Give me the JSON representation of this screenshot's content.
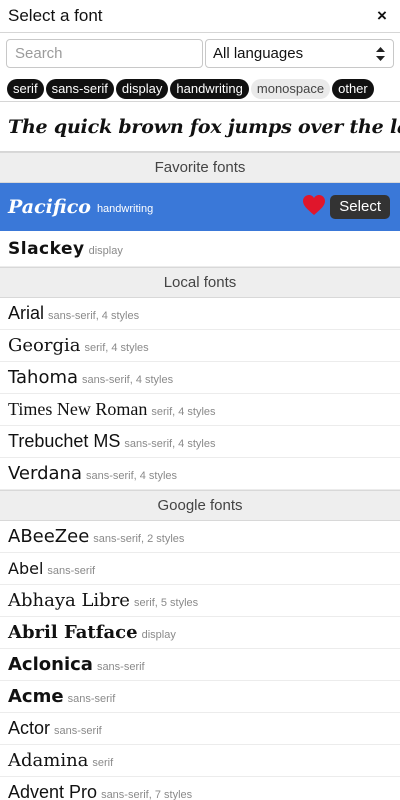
{
  "header": {
    "title": "Select a font",
    "close": "×"
  },
  "search": {
    "placeholder": "Search"
  },
  "language": {
    "selected": "All languages"
  },
  "chips": [
    {
      "label": "serif",
      "active": true
    },
    {
      "label": "sans-serif",
      "active": true
    },
    {
      "label": "display",
      "active": true
    },
    {
      "label": "handwriting",
      "active": true
    },
    {
      "label": "monospace",
      "active": false
    },
    {
      "label": "other",
      "active": true
    }
  ],
  "sample_text": "The quick brown fox jumps over the lazy dog.",
  "sections": {
    "favorite": "Favorite fonts",
    "local": "Local fonts",
    "google": "Google fonts"
  },
  "favorites": [
    {
      "name": "Pacifico",
      "meta": "handwriting",
      "selected": true,
      "action": "Select"
    },
    {
      "name": "Slackey",
      "meta": "display",
      "selected": false
    }
  ],
  "local_fonts": [
    {
      "name": "Arial",
      "meta": "sans-serif, 4 styles"
    },
    {
      "name": "Georgia",
      "meta": "serif, 4 styles"
    },
    {
      "name": "Tahoma",
      "meta": "sans-serif, 4 styles"
    },
    {
      "name": "Times New Roman",
      "meta": "serif, 4 styles"
    },
    {
      "name": "Trebuchet MS",
      "meta": "sans-serif, 4 styles"
    },
    {
      "name": "Verdana",
      "meta": "sans-serif, 4 styles"
    }
  ],
  "google_fonts": [
    {
      "name": "ABeeZee",
      "meta": "sans-serif, 2 styles"
    },
    {
      "name": "Abel",
      "meta": "sans-serif"
    },
    {
      "name": "Abhaya Libre",
      "meta": "serif, 5 styles"
    },
    {
      "name": "Abril Fatface",
      "meta": "display"
    },
    {
      "name": "Aclonica",
      "meta": "sans-serif"
    },
    {
      "name": "Acme",
      "meta": "sans-serif"
    },
    {
      "name": "Actor",
      "meta": "sans-serif"
    },
    {
      "name": "Adamina",
      "meta": "serif"
    },
    {
      "name": "Advent Pro",
      "meta": "sans-serif, 7 styles"
    }
  ],
  "colors": {
    "selected_row": "#3a78d8",
    "heart": "#e0162b",
    "chip_active": "#111111",
    "section_bg": "#eeeeee"
  },
  "icons": {
    "close": "close-icon",
    "select_arrows": "up-down-arrows-icon",
    "favorite": "heart-icon"
  }
}
